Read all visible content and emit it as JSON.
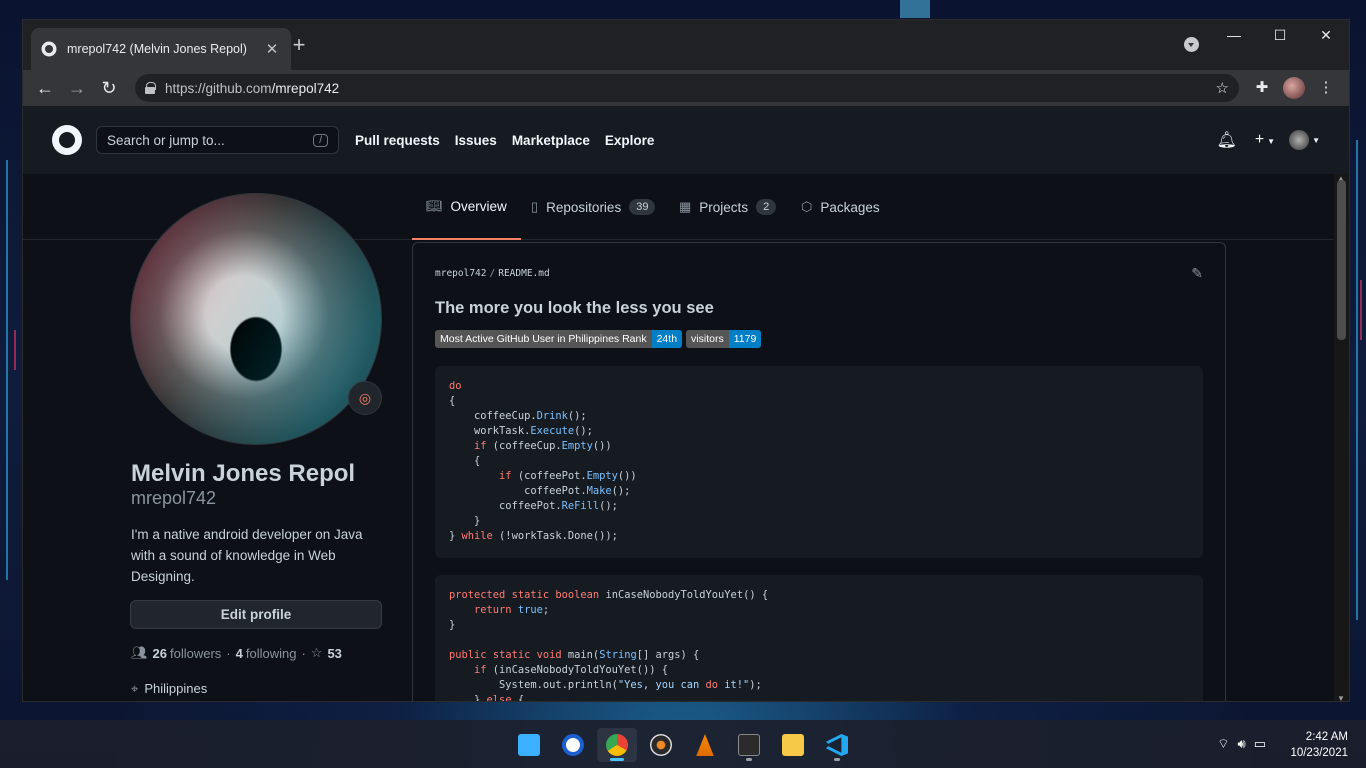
{
  "browser": {
    "tab_title": "mrepol742 (Melvin Jones Repol)",
    "tab_close": "✕",
    "new_tab": "+",
    "url_host": "https://github.com",
    "url_path": "/mrepol742",
    "min_label": "—",
    "max_label": "☐",
    "close_label": "✕"
  },
  "gh_header": {
    "search_placeholder": "Search or jump to...",
    "search_kbd": "/",
    "nav": [
      "Pull requests",
      "Issues",
      "Marketplace",
      "Explore"
    ]
  },
  "profile_tabs": [
    {
      "label": "Overview",
      "icon": "book-icon"
    },
    {
      "label": "Repositories",
      "count": "39",
      "icon": "repo-icon"
    },
    {
      "label": "Projects",
      "count": "2",
      "icon": "project-icon"
    },
    {
      "label": "Packages",
      "icon": "package-icon"
    }
  ],
  "profile": {
    "name": "Melvin Jones Repol",
    "login": "mrepol742",
    "bio": "I'm a native android developer on Java with a sound of knowledge in Web Designing.",
    "edit_button": "Edit profile",
    "followers_count": "26",
    "followers_label": "followers",
    "following_count": "4",
    "following_label": "following",
    "stars_count": "53",
    "location": "Philippines"
  },
  "readme": {
    "owner": "mrepol742",
    "file": "README.md",
    "heading": "The more you look the less you see",
    "badges": [
      {
        "label": "Most Active GitHub User in Philippines Rank",
        "value": "24th"
      },
      {
        "label": "visitors",
        "value": "1179"
      }
    ],
    "code_block_1": [
      "do",
      "{",
      "    coffeeCup.Drink();",
      "    workTask.Execute();",
      "    if (coffeeCup.Empty())",
      "    {",
      "        if (coffeePot.Empty())",
      "            coffeePot.Make();",
      "        coffeePot.ReFill();",
      "    }",
      "} while (!workTask.Done());"
    ],
    "code_block_2": [
      "protected static boolean inCaseNobodyToldYouYet() {",
      "    return true;",
      "}",
      "",
      "public static void main(String[] args) {",
      "    if (inCaseNobodyToldYouYet()) {",
      "        System.out.println(\"Yes, you can do it!\");",
      "    } else {"
    ]
  },
  "taskbar": {
    "time": "2:42 AM",
    "date": "10/23/2021",
    "apps": [
      "windows-start",
      "app-m",
      "chrome",
      "media-player",
      "vlc",
      "terminal",
      "file-explorer",
      "vscode"
    ]
  },
  "colors": {
    "gh_bg": "#0d1117",
    "gh_header": "#161b22",
    "accent_tab": "#f78166",
    "badge_value": "#007ec6"
  }
}
